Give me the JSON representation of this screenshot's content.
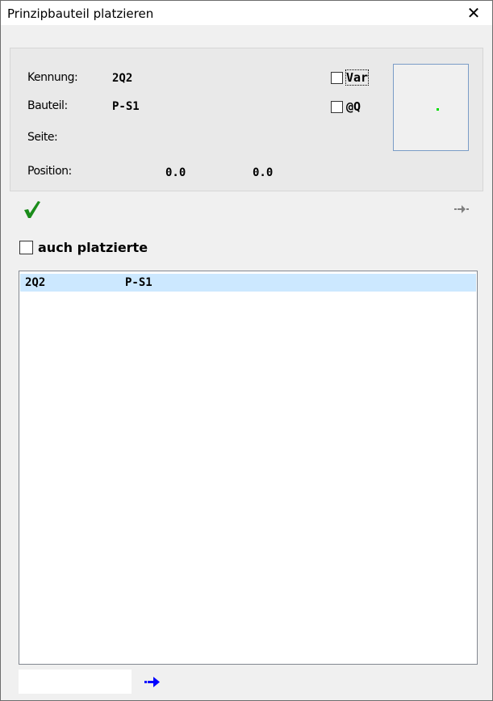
{
  "window": {
    "title": "Prinzipbauteil platzieren",
    "close_glyph": "✕"
  },
  "info": {
    "kennung_label": "Kennung:",
    "kennung_value": "2Q2",
    "bauteil_label": "Bauteil:",
    "bauteil_value": "P-S1",
    "seite_label": "Seite:",
    "seite_value": "",
    "position_label": "Position:",
    "position_x": "0.0",
    "position_y": "0.0"
  },
  "options": {
    "var_label": "Var",
    "var_checked": false,
    "atq_label": "@Q",
    "atq_checked": false,
    "auch_platzierte_label": "auch platzierte",
    "auch_platzierte_checked": false
  },
  "icons": {
    "ok": "checkmark-icon",
    "goto_small": "arrow-right-small-icon",
    "goto": "arrow-right-icon"
  },
  "colors": {
    "checkmark": "#1a8c1a",
    "selection": "#cce8ff",
    "arrow_blue": "#0000ff",
    "arrow_gray": "#808080",
    "preview_dot": "#00dd00"
  },
  "list": {
    "rows": [
      {
        "kennung": "2Q2",
        "bauteil": "P-S1",
        "selected": true
      }
    ]
  },
  "search": {
    "value": "",
    "placeholder": ""
  }
}
